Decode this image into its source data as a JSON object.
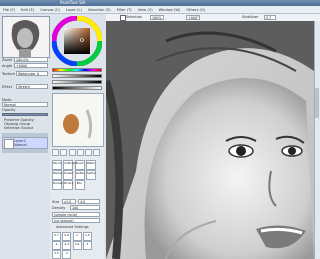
{
  "window": {
    "title": "PaintTool SAI"
  },
  "menu": [
    "File (F)",
    "Edit (E)",
    "Canvas (C)",
    "Layer (L)",
    "Selection (S)",
    "Filter (T)",
    "View (V)",
    "Window (W)",
    "Others (O)"
  ],
  "toolbar": {
    "selection_label": "Selection",
    "zoom_value": "100%",
    "angle_value": "+000°",
    "stabilizer_label": "Stabilizer",
    "stabilizer_value": "S-7"
  },
  "navigator": {
    "zoom_label": "Zoom",
    "zoom_value": "200.0%",
    "angle_label": "Angle",
    "angle_value": "+0000"
  },
  "layer_props": {
    "texture_label": "Texture",
    "texture_value": "Watercolor A",
    "effect_label": "Effect",
    "effect_value": "Stretch",
    "blend_label": "Mode",
    "blend_value": "Normal",
    "opacity_label": "Opacity",
    "opacity_value": 100,
    "options": [
      "Preserve Opacity",
      "Clipping Group",
      "Selection Source"
    ]
  },
  "layers": [
    {
      "name": "Layer1",
      "mode": "Normal",
      "opacity": "100%"
    }
  ],
  "tools": {
    "brush_labels": [
      "Pencil",
      "AirBrush",
      "Brush",
      "Water",
      "Marker",
      "Eraser",
      "SelPen",
      "SelErs",
      "Bucket",
      "Binary",
      "Blur"
    ],
    "size_label": "Size",
    "size_value": "x1.0",
    "size_num": "4.0",
    "density_label": "Density",
    "density_value": 100,
    "shape_value": "(simple circle)",
    "texture_value": "(no texture)",
    "advanced_label": "Advanced Settings"
  },
  "brush_sizes": [
    "0.7",
    "0.8",
    "1",
    "1.5",
    "2",
    "2.3",
    "2.6",
    "3",
    "3.5",
    "4"
  ],
  "colors": {
    "accent": "#4f6f94",
    "panel": "#dde3ea"
  }
}
